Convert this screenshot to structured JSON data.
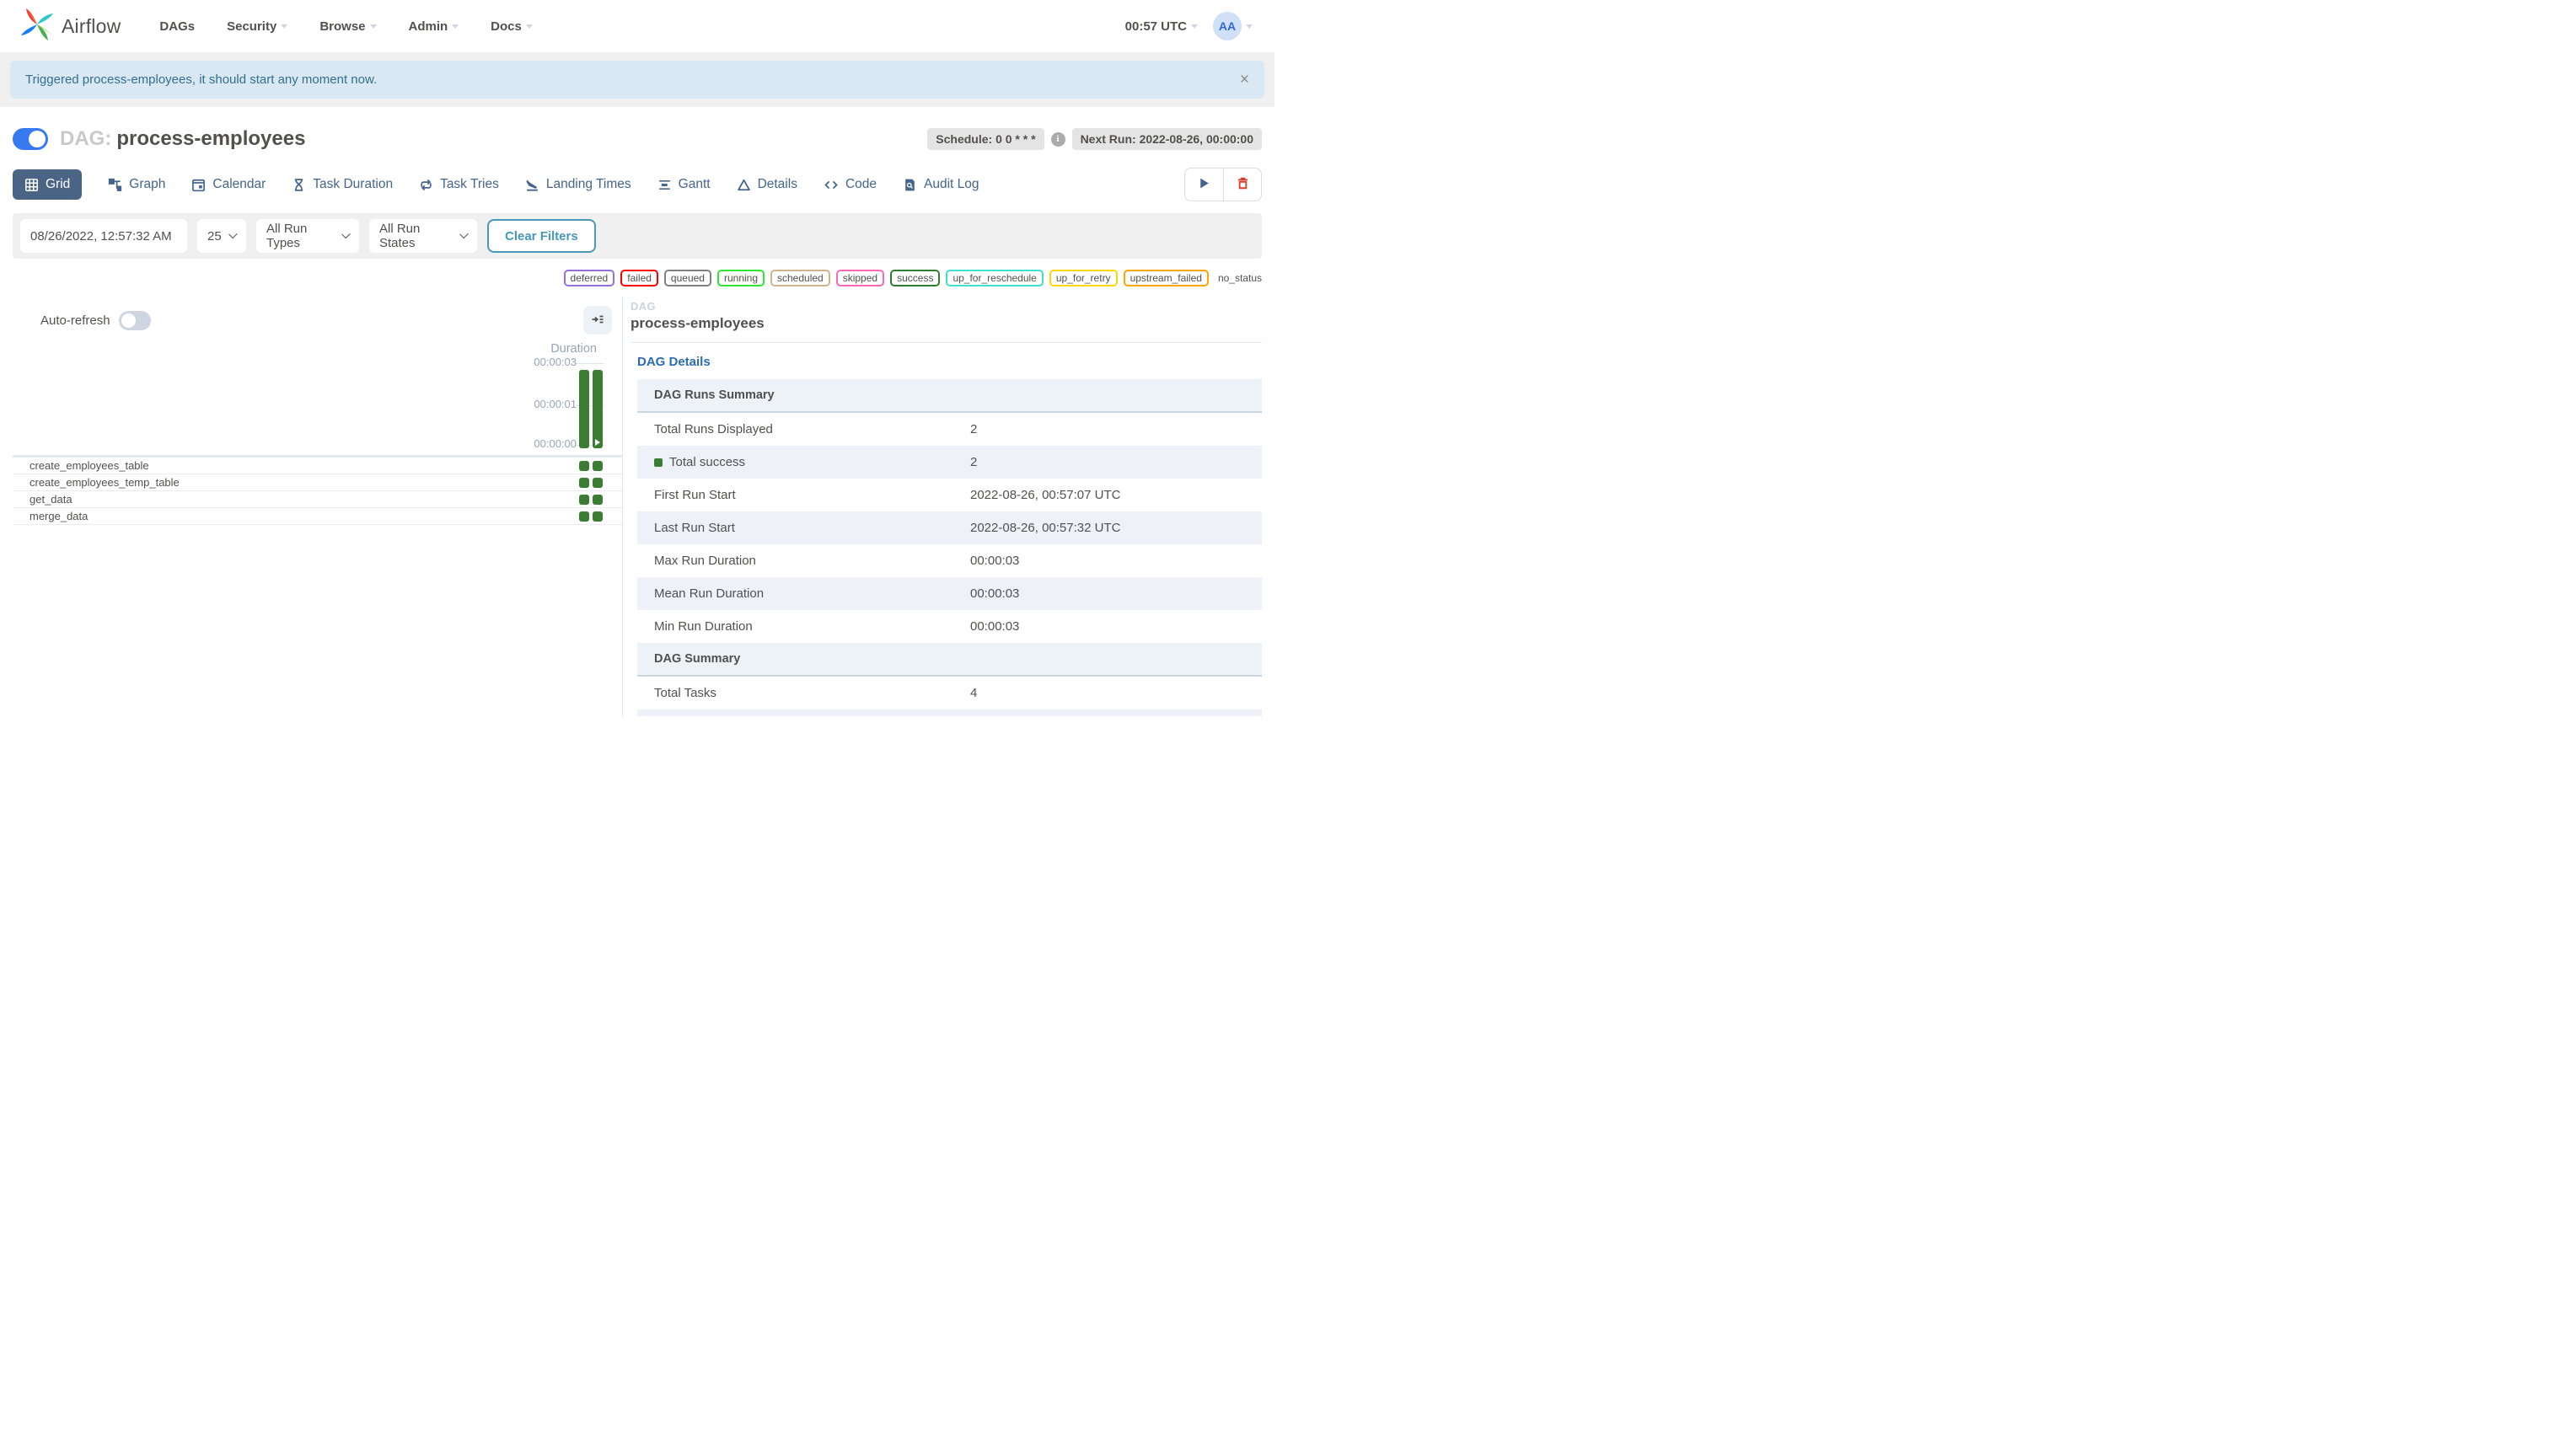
{
  "navbar": {
    "brand": "Airflow",
    "items": [
      {
        "label": "DAGs",
        "caret": false
      },
      {
        "label": "Security",
        "caret": true
      },
      {
        "label": "Browse",
        "caret": true
      },
      {
        "label": "Admin",
        "caret": true
      },
      {
        "label": "Docs",
        "caret": true
      }
    ],
    "clock": "00:57 UTC",
    "avatar_initials": "AA"
  },
  "alert": {
    "message": "Triggered process-employees, it should start any moment now.",
    "close_label": "×"
  },
  "dag_header": {
    "toggle_on": true,
    "prefix": "DAG:",
    "name": "process-employees",
    "schedule_badge": "Schedule: 0 0 * * *",
    "next_run_badge": "Next Run: 2022-08-26, 00:00:00"
  },
  "tabs": [
    {
      "label": "Grid",
      "icon": "grid-icon",
      "active": true
    },
    {
      "label": "Graph",
      "icon": "graph-icon",
      "active": false
    },
    {
      "label": "Calendar",
      "icon": "calendar-icon",
      "active": false
    },
    {
      "label": "Task Duration",
      "icon": "hourglass-icon",
      "active": false
    },
    {
      "label": "Task Tries",
      "icon": "repeat-icon",
      "active": false
    },
    {
      "label": "Landing Times",
      "icon": "plane-landing-icon",
      "active": false
    },
    {
      "label": "Gantt",
      "icon": "gantt-icon",
      "active": false
    },
    {
      "label": "Details",
      "icon": "triangle-icon",
      "active": false
    },
    {
      "label": "Code",
      "icon": "code-icon",
      "active": false
    },
    {
      "label": "Audit Log",
      "icon": "audit-log-icon",
      "active": false
    }
  ],
  "filters": {
    "date_value": "08/26/2022, 12:57:32 AM",
    "page_size": "25",
    "run_types": "All Run Types",
    "run_states": "All Run States",
    "clear_label": "Clear Filters"
  },
  "legend": {
    "statuses": [
      {
        "label": "deferred",
        "color": "#9370DB"
      },
      {
        "label": "failed",
        "color": "#ff0000"
      },
      {
        "label": "queued",
        "color": "#808080"
      },
      {
        "label": "running",
        "color": "#32e532"
      },
      {
        "label": "scheduled",
        "color": "#D2B48C"
      },
      {
        "label": "skipped",
        "color": "#FF69B4"
      },
      {
        "label": "success",
        "color": "#2e7d32"
      },
      {
        "label": "up_for_reschedule",
        "color": "#40E0D0"
      },
      {
        "label": "up_for_retry",
        "color": "#FFD700"
      },
      {
        "label": "upstream_failed",
        "color": "#FFA500"
      }
    ],
    "no_status_label": "no_status"
  },
  "grid_panel": {
    "auto_refresh_label": "Auto-refresh",
    "auto_refresh_on": false,
    "chart": {
      "axis_label": "Duration",
      "ticks": [
        "00:00:03",
        "00:00:01",
        "00:00:00"
      ],
      "bar_color": "#3b7d32",
      "runs": [
        {
          "duration": "00:00:03",
          "duration_seconds": 3,
          "state": "success",
          "manually_triggered": false
        },
        {
          "duration": "00:00:03",
          "duration_seconds": 3,
          "state": "success",
          "manually_triggered": true
        }
      ]
    },
    "tasks": [
      {
        "name": "create_employees_table",
        "instances": [
          "success",
          "success"
        ]
      },
      {
        "name": "create_employees_temp_table",
        "instances": [
          "success",
          "success"
        ]
      },
      {
        "name": "get_data",
        "instances": [
          "success",
          "success"
        ]
      },
      {
        "name": "merge_data",
        "instances": [
          "success",
          "success"
        ]
      }
    ]
  },
  "details_panel": {
    "label": "DAG",
    "dag_name": "process-employees",
    "details_tab_label": "DAG Details",
    "sections": [
      {
        "header": "DAG Runs Summary",
        "rows": [
          {
            "label": "Total Runs Displayed",
            "value": "2"
          },
          {
            "label": "Total success",
            "value": "2",
            "swatch": "#3b7d32"
          },
          {
            "label": "First Run Start",
            "value": "2022-08-26, 00:57:07 UTC"
          },
          {
            "label": "Last Run Start",
            "value": "2022-08-26, 00:57:32 UTC"
          },
          {
            "label": "Max Run Duration",
            "value": "00:00:03"
          },
          {
            "label": "Mean Run Duration",
            "value": "00:00:03"
          },
          {
            "label": "Min Run Duration",
            "value": "00:00:03"
          }
        ]
      },
      {
        "header": "DAG Summary",
        "rows": [
          {
            "label": "Total Tasks",
            "value": "4"
          }
        ]
      }
    ]
  },
  "colors": {
    "success_green": "#3b7d32",
    "tab_blue": "#44658c",
    "active_tab_bg": "#4a6485",
    "link_blue": "#2b6cb0",
    "alert_bg": "#d9e8f2",
    "alert_text": "#31708f",
    "clear_filters_teal": "#4799bc",
    "toggle_on_blue": "#3779f1",
    "delete_red": "#d9402e"
  }
}
